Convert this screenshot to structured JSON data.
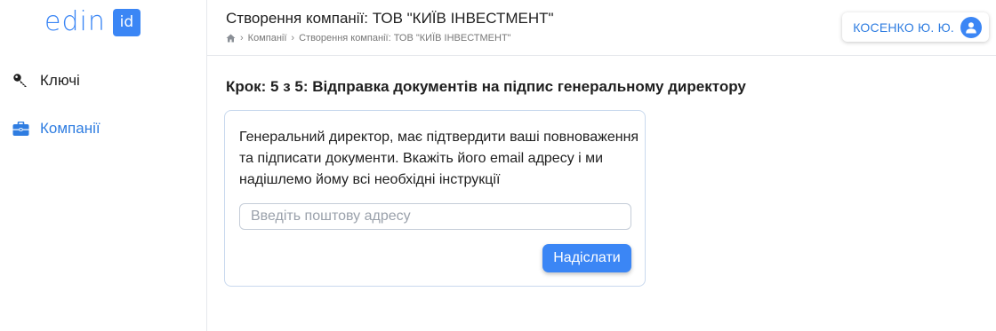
{
  "brand": {
    "logo_text": "edin",
    "logo_badge": "id",
    "accent_color": "#3b86f5"
  },
  "sidebar": {
    "items": [
      {
        "label": "Ключі",
        "icon": "key-icon"
      },
      {
        "label": "Компанії",
        "icon": "briefcase-icon",
        "active": true
      }
    ]
  },
  "header": {
    "title": "Створення компанії: ТОВ \"КИЇВ ІНВЕСТМЕНТ\"",
    "breadcrumb": {
      "home_icon": "home-icon",
      "items": [
        "Компанії",
        "Створення компанії: ТОВ \"КИЇВ ІНВЕСТМЕНТ\""
      ]
    },
    "user": {
      "name": "КОСЕНКО Ю. Ю.",
      "icon": "user-avatar-icon"
    }
  },
  "main": {
    "step_title": "Крок: 5 з 5: Відправка документів на підпис генеральному директору",
    "card": {
      "text": "Генеральний директор, має підтвердити ваші повноваження та підписати документи. Вкажіть його email адресу і ми надішлемо йому всі необхідні інструкції",
      "email_input": {
        "value": "",
        "placeholder": "Введіть поштову адресу"
      },
      "send_label": "Надіслати"
    }
  }
}
